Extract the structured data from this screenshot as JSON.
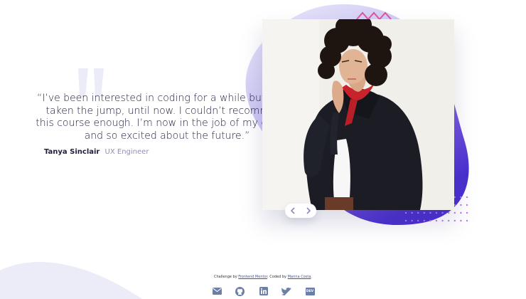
{
  "testimonial": {
    "quote": "“I’ve been interested in coding for a while but never taken the jump, until now. I couldn’t recommend this course enough. I’m now in the job of my dreams and so excited about the future.”",
    "name": "Tanya Sinclair",
    "role": "UX Engineer"
  },
  "slider": {
    "prev_icon": "chevron-left-icon",
    "next_icon": "chevron-right-icon"
  },
  "footer": {
    "prefix": "Challenge by ",
    "fm_link": "Frontend Mentor",
    "middle": ". Coded by ",
    "author_link": "Marina Costa",
    "suffix": ".",
    "socials": [
      {
        "name": "email-icon"
      },
      {
        "name": "github-icon"
      },
      {
        "name": "linkedin-icon"
      },
      {
        "name": "twitter-icon"
      },
      {
        "name": "dev-icon",
        "label": "DEV"
      }
    ]
  },
  "colors": {
    "text_dark": "#202040",
    "text_muted": "#8f8fb8",
    "blob_gradient_start": "#e9e8fb",
    "blob_gradient_end": "#4a2ed0",
    "accent_pink": "#e0559a",
    "dot_purple": "#b87be6",
    "icon_gray": "#6b7fa8"
  }
}
